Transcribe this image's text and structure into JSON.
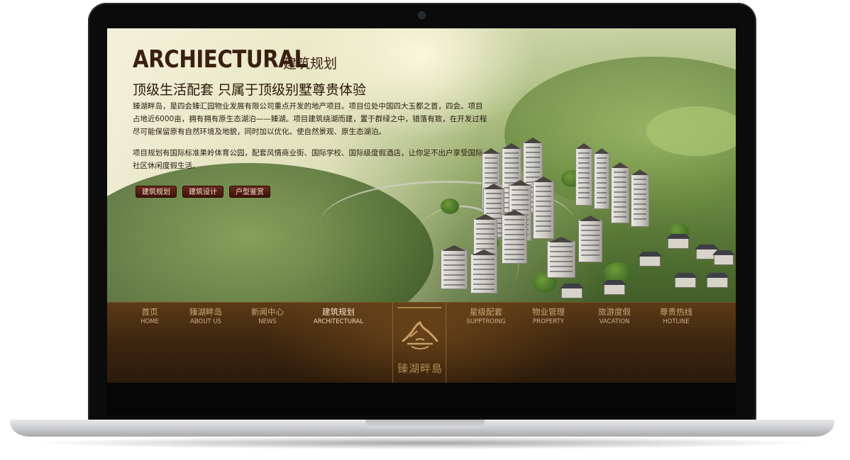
{
  "hero": {
    "brand_en": "ARCHIECTURAL",
    "brand_cn": "建筑规划",
    "subtitle": "顶级生活配套 只属于顶级别墅尊贵体验",
    "paragraph1": "臻湖畔岛，是四会臻汇园物业发展有限公司重点开发的地产项目。项目位处中国四大玉都之首，四会。项目占地近6000亩，拥有拥有原生态湖泊——臻湖。项目建筑绕湖而建，置于群绿之中，错落有致，在开发过程尽可能保留原有自然环境及地貌，同时加以优化。使自然景观、原生态湖泊。",
    "paragraph2": "项目规划有国际标准果岭体育公园，配套风情商业街、国际学校、国际级度假酒店，让你足不出户享受国际社区休闲度假生活。",
    "buttons": [
      "建筑规划",
      "建筑设计",
      "户型鉴赏"
    ]
  },
  "nav": {
    "left": [
      {
        "cn": "首页",
        "en": "HOME"
      },
      {
        "cn": "臻湖畔岛",
        "en": "ABOUT US"
      },
      {
        "cn": "新闻中心",
        "en": "NEWS"
      },
      {
        "cn": "建筑规划",
        "en": "ARCHITECTURAL"
      }
    ],
    "right": [
      {
        "cn": "星级配套",
        "en": "SUPPTROING"
      },
      {
        "cn": "物业管理",
        "en": "PROPERTY"
      },
      {
        "cn": "旅游度假",
        "en": "VACATION"
      },
      {
        "cn": "尊贵热线",
        "en": "HOTLINE"
      }
    ],
    "active": "建筑规划"
  },
  "logo": {
    "text": "臻湖畔島"
  },
  "colors": {
    "nav_bg": "#3f2710",
    "button_bg": "#5a1f14",
    "heading": "#3a1f10",
    "nav_text": "#c9a778"
  }
}
